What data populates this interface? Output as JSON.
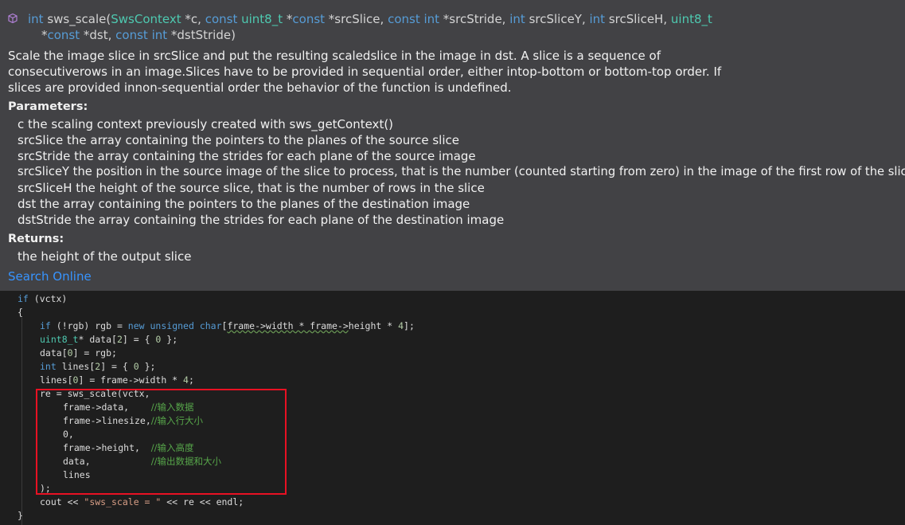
{
  "tooltip": {
    "signature_line1": {
      "ret": "int",
      "name": "sws_scale",
      "paren_open": "(",
      "p1_type": "SwsContext",
      "p1_name": " *c, ",
      "p2_kw": "const",
      "p2_type": " uint8_t",
      "p2_rest": " *",
      "p2_kw2": "const",
      "p2_name": " *srcSlice, ",
      "p3_kw": "const int",
      "p3_name": " *srcStride, ",
      "p4_kw": "int",
      "p4_name": " srcSliceY, ",
      "p5_kw": "int",
      "p5_name": " srcSliceH, ",
      "p6_type": "uint8_t"
    },
    "signature_line2": {
      "p6_rest": "*",
      "p6_kw": "const",
      "p6_name": " *dst, ",
      "p7_kw": "const int",
      "p7_name": " *dstStride)"
    },
    "description": [
      "Scale the image slice in srcSlice and put the resulting scaledslice in the image in dst. A slice is a sequence of",
      "consecutiverows in an image.Slices have to be provided in sequential order, either intop-bottom or bottom-top order. If",
      "slices are provided innon-sequential order the behavior of the function is undefined."
    ],
    "parameters_title": "Parameters:",
    "parameters": [
      "c the scaling context previously created with sws_getContext()",
      "srcSlice the array containing the pointers to the planes of the source slice",
      "srcStride the array containing the strides for each plane of the source image",
      "srcSliceY the position in the source image of the slice to process, that is the number (counted starting from zero) in the image of the first row of the slice",
      "srcSliceH the height of the source slice, that is the number of rows in the slice",
      "dst the array containing the pointers to the planes of the destination image",
      "dstStride the array containing the strides for each plane of the destination image"
    ],
    "returns_title": "Returns:",
    "returns": "the height of the output slice",
    "search_link": "Search Online",
    "icon": "cube-method-icon"
  },
  "code": {
    "l1": {
      "a": "if",
      "b": " (vctx)"
    },
    "l2": "{",
    "l3": {
      "a": "if",
      "b": " (!rgb) rgb = ",
      "c": "new",
      "d": " unsigned char",
      "e": "[",
      "f": "frame->width * frame->",
      "g": "height * ",
      "h": "4",
      "i": "];"
    },
    "l4": {
      "a": "uint8_t",
      "b": "* data[",
      "c": "2",
      "d": "] = { ",
      "e": "0",
      "f": " };"
    },
    "l5": {
      "a": "data[",
      "b": "0",
      "c": "] = rgb;"
    },
    "l6": {
      "a": "int",
      "b": " lines[",
      "c": "2",
      "d": "] = { ",
      "e": "0",
      "f": " };"
    },
    "l7": {
      "a": "lines[",
      "b": "0",
      "c": "] = frame->width * ",
      "d": "4",
      "e": ";"
    },
    "l8": "re = sws_scale(vctx,",
    "l9": {
      "a": "frame->data,    ",
      "b": "//输入数据"
    },
    "l10": {
      "a": "frame->linesize,",
      "b": "//输入行大小"
    },
    "l11": "0,",
    "l12": {
      "a": "frame->height,  ",
      "b": "//输入高度"
    },
    "l13": {
      "a": "data,           ",
      "b": "//输出数据和大小"
    },
    "l14": "lines",
    "l15": ");",
    "l16": {
      "a": "cout << ",
      "b": "\"sws_scale = \"",
      "c": " << re << endl;"
    },
    "l17": "}"
  }
}
